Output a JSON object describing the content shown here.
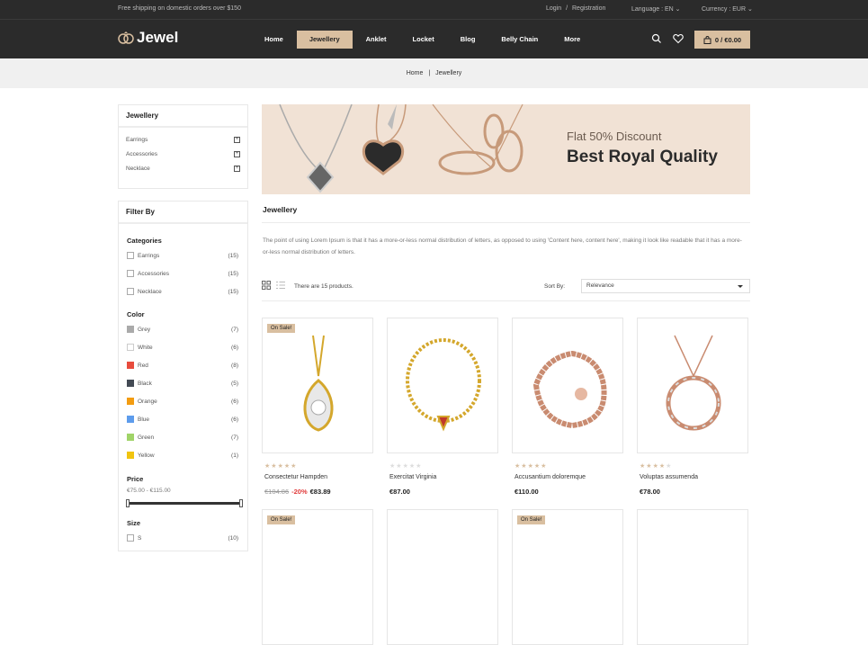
{
  "topbar": {
    "shipping": "Free shipping on domestic orders over $150",
    "login": "Login",
    "sep": "/",
    "registration": "Registration",
    "language": "Language : EN",
    "currency": "Currency : EUR"
  },
  "header": {
    "logo": "Jewel",
    "nav": [
      "Home",
      "Jewellery",
      "Anklet",
      "Locket",
      "Blog",
      "Belly Chain",
      "More"
    ],
    "active": "Jewellery",
    "cart": "0 / €0.00"
  },
  "breadcrumb": {
    "home": "Home",
    "sep": "|",
    "current": "Jewellery"
  },
  "sidebar": {
    "categories_title": "Jewellery",
    "categories": [
      "Earrings",
      "Accessories",
      "Necklace"
    ],
    "filter_title": "Filter By",
    "cat_heading": "Categories",
    "cat_filters": [
      {
        "label": "Earrings",
        "count": "(15)"
      },
      {
        "label": "Accessories",
        "count": "(15)"
      },
      {
        "label": "Necklace",
        "count": "(15)"
      }
    ],
    "color_heading": "Color",
    "colors": [
      {
        "label": "Grey",
        "count": "(7)",
        "hex": "#aaaaaa"
      },
      {
        "label": "White",
        "count": "(6)",
        "hex": "#ffffff"
      },
      {
        "label": "Red",
        "count": "(8)",
        "hex": "#e84c3d"
      },
      {
        "label": "Black",
        "count": "(5)",
        "hex": "#434a54"
      },
      {
        "label": "Orange",
        "count": "(6)",
        "hex": "#f39c11"
      },
      {
        "label": "Blue",
        "count": "(6)",
        "hex": "#5d9cec"
      },
      {
        "label": "Green",
        "count": "(7)",
        "hex": "#a0d468"
      },
      {
        "label": "Yellow",
        "count": "(1)",
        "hex": "#f1c40f"
      }
    ],
    "price_heading": "Price",
    "price_range": "€75.00 - €115.00",
    "size_heading": "Size",
    "sizes": [
      {
        "label": "S",
        "count": "(10)"
      }
    ]
  },
  "banner": {
    "line1": "Flat 50% Discount",
    "line2": "Best Royal Quality"
  },
  "main": {
    "title": "Jewellery",
    "description": "The point of using Lorem Ipsum is that it has a more-or-less normal distribution of letters, as opposed to using 'Content here, content here', making it look like readable that it has a more-or-less normal distribution of letters.",
    "count": "There are 15 products.",
    "sort_label": "Sort By:",
    "sort_value": "Relevance"
  },
  "products": [
    {
      "name": "Consectetur Hampden",
      "badge": "On Sale!",
      "old_price": "€104.86",
      "discount": "-20%",
      "price": "€83.89",
      "rating": 5
    },
    {
      "name": "Exercitat Virginia",
      "badge": "",
      "old_price": "",
      "discount": "",
      "price": "€87.00",
      "rating": 0
    },
    {
      "name": "Accusantium doloremque",
      "badge": "",
      "old_price": "",
      "discount": "",
      "price": "€110.00",
      "rating": 5
    },
    {
      "name": "Voluptas assumenda",
      "badge": "",
      "old_price": "",
      "discount": "",
      "price": "€78.00",
      "rating": 4
    }
  ],
  "products_row2": [
    {
      "badge": "On Sale!"
    },
    {
      "badge": ""
    },
    {
      "badge": "On Sale!"
    },
    {
      "badge": ""
    }
  ],
  "colors": {
    "accent": "#d9bfa0",
    "dark": "#2b2b2b",
    "sale": "#e03b3b",
    "star": "#d9bfa0"
  }
}
